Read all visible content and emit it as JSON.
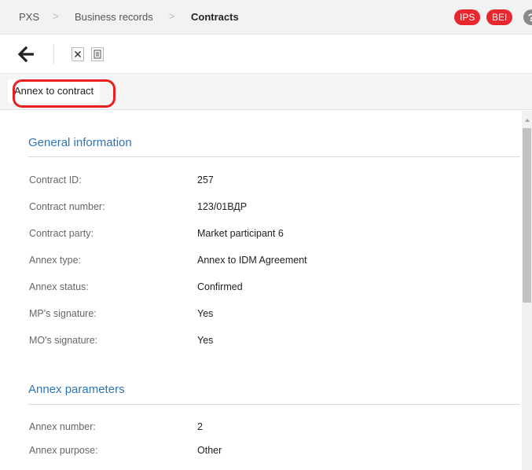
{
  "breadcrumb": {
    "items": [
      "PXS",
      "Business records",
      "Contracts"
    ],
    "separator": ">"
  },
  "badges": {
    "ips": "IPS",
    "bei": "BEI",
    "help": "?"
  },
  "toolbar": {
    "back_icon": "arrow-left-icon",
    "export_excel_icon": "excel-file-icon",
    "export_doc_icon": "document-icon"
  },
  "tabs": [
    {
      "label": "Annex to contract"
    }
  ],
  "general": {
    "title": "General information",
    "fields": [
      {
        "label": "Contract ID:",
        "value": "257"
      },
      {
        "label": "Contract number:",
        "value": "123/01ВДР"
      },
      {
        "label": "Contract party:",
        "value": "Market participant 6"
      },
      {
        "label": "Annex type:",
        "value": "Annex to IDM Agreement"
      },
      {
        "label": "Annex status:",
        "value": "Confirmed"
      },
      {
        "label": "MP's signature:",
        "value": "Yes"
      },
      {
        "label": "MO's signature:",
        "value": "Yes"
      }
    ]
  },
  "annex": {
    "title": "Annex parameters",
    "fields": [
      {
        "label": "Annex number:",
        "value": "2"
      },
      {
        "label": "Annex purpose:",
        "value": "Other"
      }
    ]
  },
  "colors": {
    "accent": "#2e75b5",
    "badge": "#e8262e",
    "highlight": "#e8201f"
  }
}
